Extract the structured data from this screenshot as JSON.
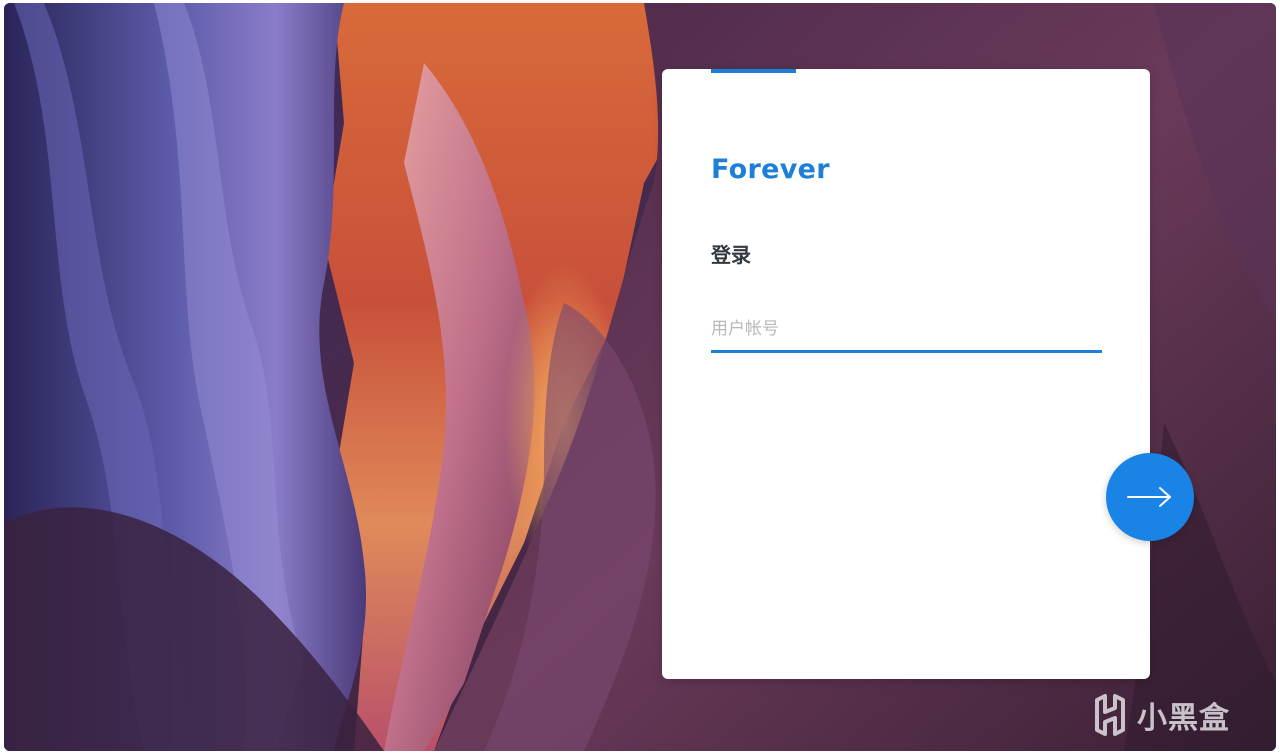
{
  "brand": {
    "name": "Forever",
    "color": "#1e7fd9"
  },
  "login": {
    "heading": "登录",
    "username_placeholder": "用户帐号",
    "username_value": "",
    "next_icon": "arrow-right-icon"
  },
  "watermark": {
    "text": "小黑盒",
    "icon": "heybox-logo-icon"
  },
  "colors": {
    "accent": "#1e7fd9",
    "button": "#1a84e6",
    "heading": "#333940"
  }
}
